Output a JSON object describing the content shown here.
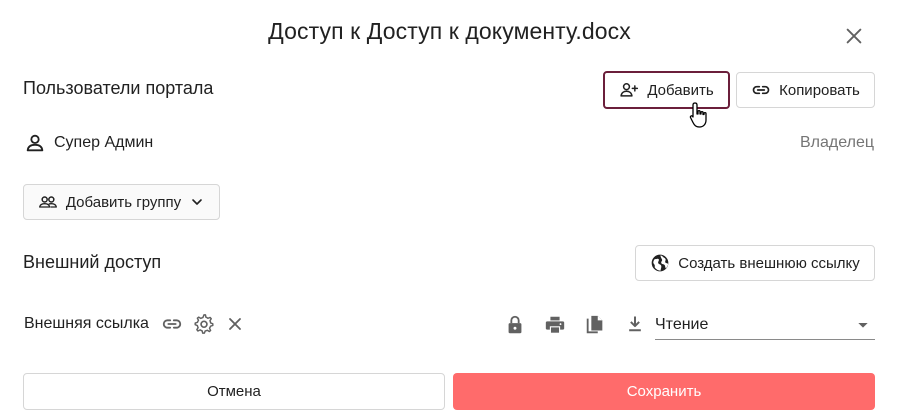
{
  "dialog": {
    "title": "Доступ к Доступ к документу.docx"
  },
  "portal_users": {
    "label": "Пользователи портала",
    "add_button": "Добавить",
    "copy_button": "Копировать",
    "users": [
      {
        "name": "Супер Админ",
        "role": "Владелец"
      }
    ],
    "add_group_button": "Добавить группу"
  },
  "external_access": {
    "label": "Внешний доступ",
    "create_link_button": "Создать внешнюю ссылку",
    "link_label": "Внешняя ссылка",
    "permission": {
      "selected": "Чтение"
    }
  },
  "footer": {
    "cancel": "Отмена",
    "save": "Сохранить"
  },
  "colors": {
    "accent": "#ff6b6b",
    "active_border": "#6b1f3b",
    "muted_text": "#757575",
    "icon": "#616161"
  },
  "icons": {
    "close": "close-icon",
    "add_user": "person-add-icon",
    "link": "link-icon",
    "person": "person-icon",
    "group": "group-icon",
    "chevron": "chevron-down-icon",
    "globe": "globe-icon",
    "settings": "gear-icon",
    "lock": "lock-icon",
    "print": "print-icon",
    "copy": "copy-icon",
    "download": "download-icon",
    "dropdown": "caret-down-icon",
    "cursor": "hand-pointer-icon"
  }
}
